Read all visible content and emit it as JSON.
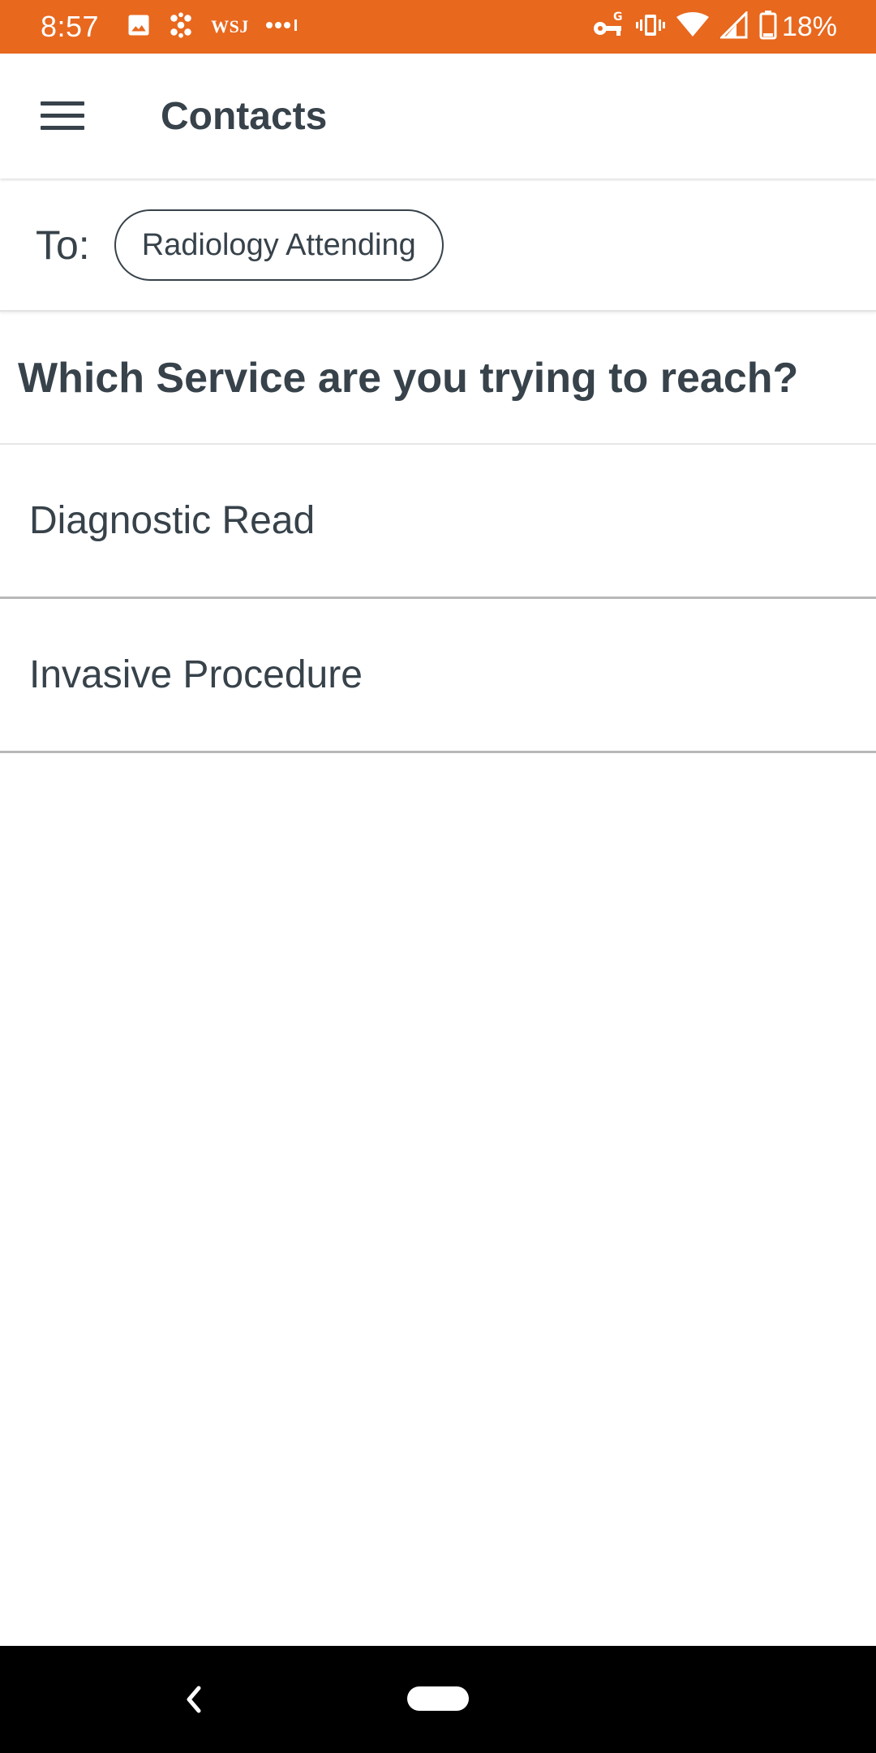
{
  "status_bar": {
    "time": "8:57",
    "background_color": "#e8681e",
    "left_icons": [
      "image-icon",
      "pinwheel-icon",
      "wsj-icon",
      "more-dots-icon"
    ],
    "wsj_text": "WSJ",
    "right_icons": [
      "vpn-key-icon",
      "vibrate-icon",
      "wifi-icon",
      "cell-signal-icon",
      "battery-icon"
    ],
    "battery_percent": "18%"
  },
  "app_bar": {
    "menu_icon": "hamburger-menu-icon",
    "title": "Contacts"
  },
  "recipient": {
    "to_label": "To:",
    "chip_label": "Radiology Attending"
  },
  "question": "Which Service are you trying to reach?",
  "services": [
    {
      "label": "Diagnostic Read"
    },
    {
      "label": "Invasive Procedure"
    }
  ],
  "nav_bar": {
    "back_icon": "back-chevron-icon",
    "home_icon": "home-pill-icon"
  }
}
